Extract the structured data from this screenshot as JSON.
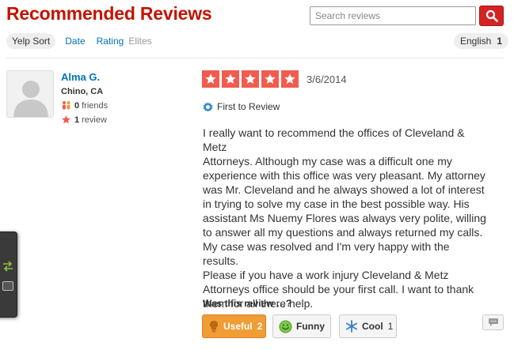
{
  "header": {
    "title": "Recommended Reviews",
    "search_placeholder": "Search reviews",
    "search_icon": "search-icon"
  },
  "sort_options": [
    {
      "label": "Yelp Sort",
      "active": true
    },
    {
      "label": "Date",
      "active": false
    },
    {
      "label": "Rating",
      "active": false
    },
    {
      "label": "Elites",
      "active": false
    }
  ],
  "language": {
    "label": "English",
    "count": "1"
  },
  "review": {
    "user": {
      "name": "Alma G.",
      "location": "Chino, CA",
      "friends_count": "0",
      "friends_label": "friends",
      "reviews_count": "1",
      "reviews_label": "review"
    },
    "rating": 5,
    "date": "3/6/2014",
    "badge": "First to Review",
    "text": "I really want to recommend the offices of Cleveland & Metz\nAttorneys. Although my case was a difficult one my\nexperience with this office was very pleasant. My attorney\nwas Mr. Cleveland and he always showed a lot of interest\nin trying to solve my case in the best possible way. His\nassistant Ms Nuemy Flores was always very polite,  willing\nto answer all my questions and always returned my calls.\nMy case was resolved and I'm very happy with the results.\nPlease if you have a work injury Cleveland & Metz\nAttorneys office should be your first call. I want to thank\nthem for all there help.",
    "vote_question": "Was this review …?",
    "votes": {
      "useful": {
        "label": "Useful",
        "count": "2"
      },
      "funny": {
        "label": "Funny",
        "count": ""
      },
      "cool": {
        "label": "Cool",
        "count": "1"
      }
    }
  },
  "colors": {
    "brand_red": "#c41200",
    "star_red": "#f15c4f",
    "link_blue": "#0073bb",
    "useful_orange": "#f19c35"
  }
}
